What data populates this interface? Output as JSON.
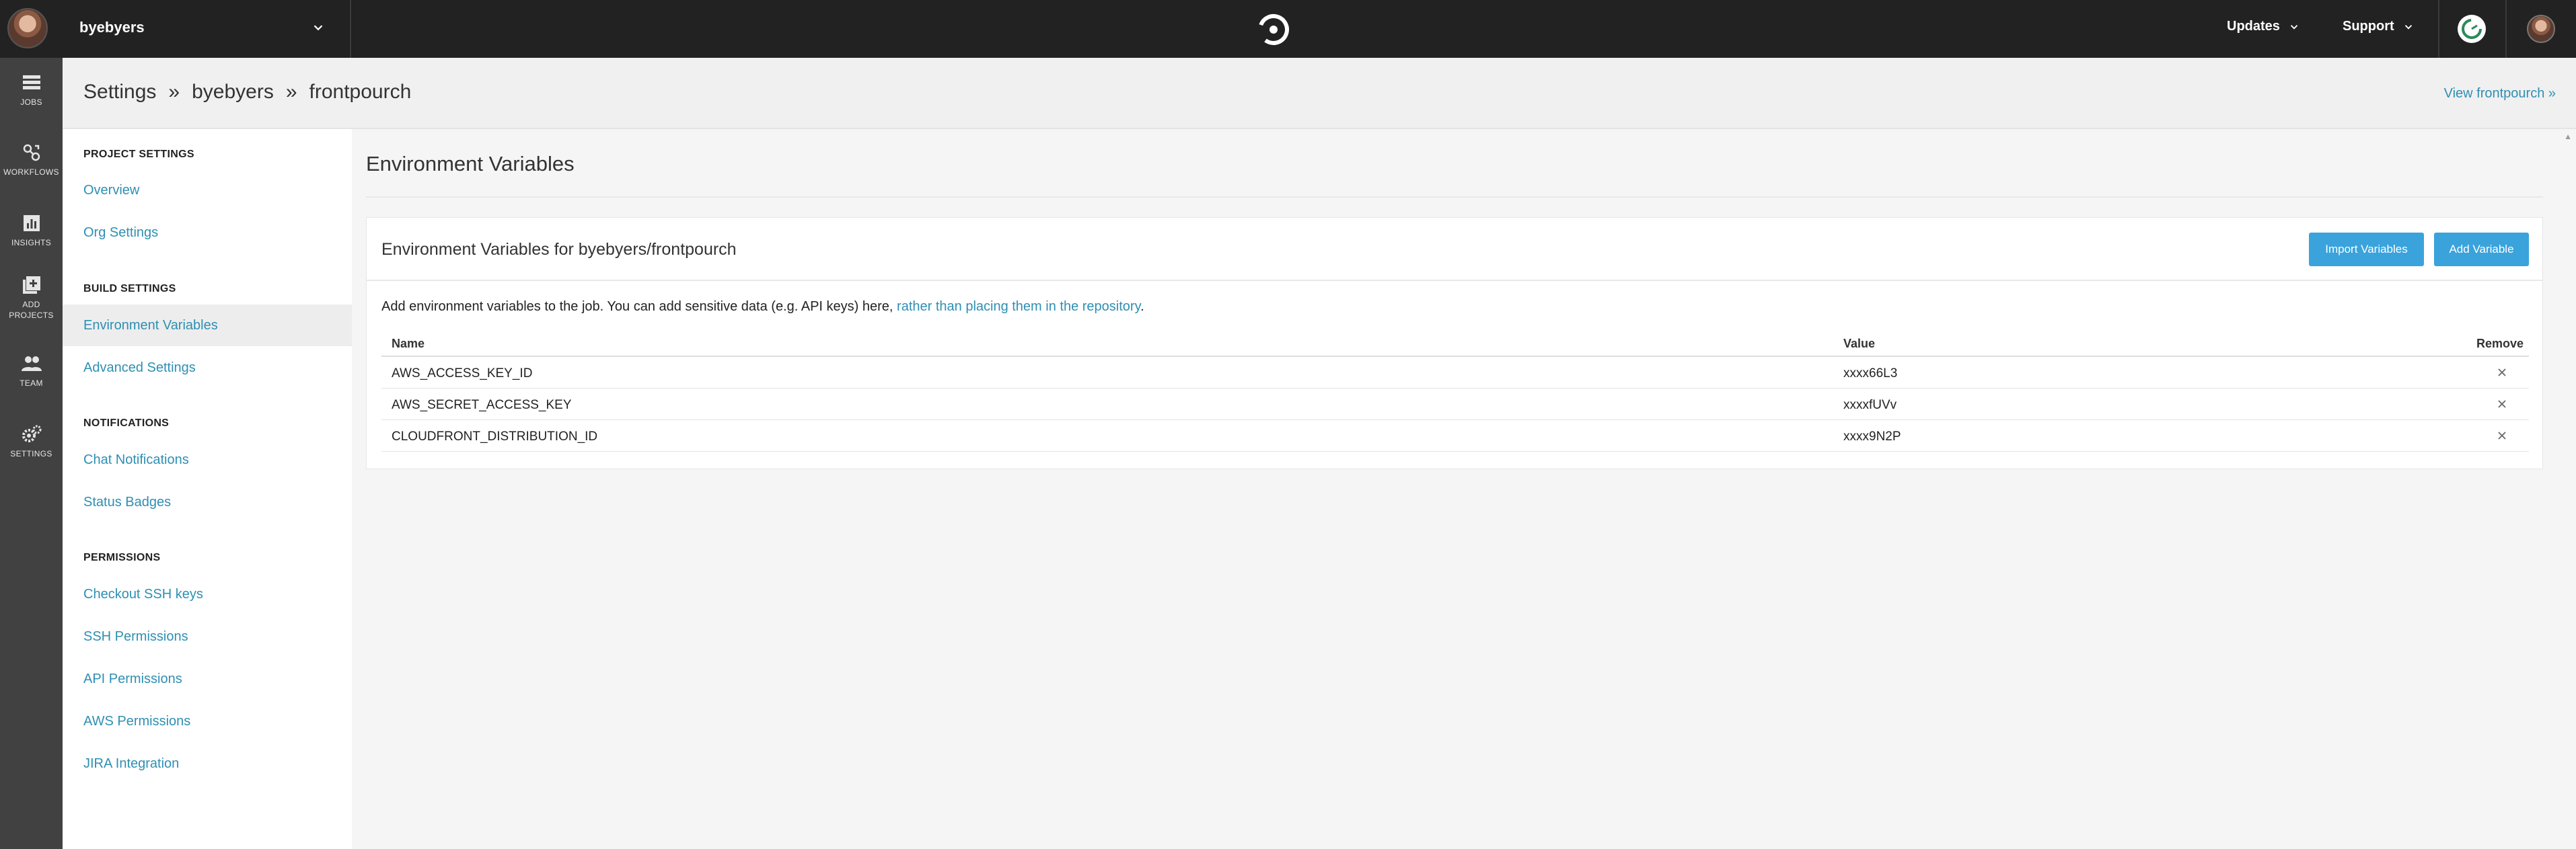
{
  "topbar": {
    "org_name": "byebyers",
    "updates_label": "Updates",
    "support_label": "Support"
  },
  "leftnav": {
    "items": [
      {
        "label": "JOBS",
        "icon": "jobs-icon"
      },
      {
        "label": "WORKFLOWS",
        "icon": "workflows-icon"
      },
      {
        "label": "INSIGHTS",
        "icon": "insights-icon"
      },
      {
        "label_line1": "ADD",
        "label_line2": "PROJECTS",
        "icon": "add-projects-icon"
      },
      {
        "label": "TEAM",
        "icon": "team-icon"
      },
      {
        "label": "SETTINGS",
        "icon": "settings-icon"
      }
    ]
  },
  "breadcrumb": {
    "root": "Settings",
    "org": "byebyers",
    "project": "frontpourch",
    "separator": "»",
    "view_link": "View frontpourch »"
  },
  "sidebar": {
    "project_settings": {
      "heading": "PROJECT SETTINGS",
      "links": [
        "Overview",
        "Org Settings"
      ]
    },
    "build_settings": {
      "heading": "BUILD SETTINGS",
      "links": [
        "Environment Variables",
        "Advanced Settings"
      ]
    },
    "notifications": {
      "heading": "NOTIFICATIONS",
      "links": [
        "Chat Notifications",
        "Status Badges"
      ]
    },
    "permissions": {
      "heading": "PERMISSIONS",
      "links": [
        "Checkout SSH keys",
        "SSH Permissions",
        "API Permissions",
        "AWS Permissions",
        "JIRA Integration"
      ]
    }
  },
  "main": {
    "title": "Environment Variables",
    "card_title": "Environment Variables for byebyers/frontpourch",
    "import_button": "Import Variables",
    "add_button": "Add Variable",
    "description": "Add environment variables to the job. You can add sensitive data (e.g. API keys) here,",
    "description_link": "rather than placing them in the repository",
    "description_end": ".",
    "table": {
      "headers": {
        "name": "Name",
        "value": "Value",
        "remove": "Remove"
      },
      "rows": [
        {
          "name": "AWS_ACCESS_KEY_ID",
          "value": "xxxx66L3"
        },
        {
          "name": "AWS_SECRET_ACCESS_KEY",
          "value": "xxxxfUVv"
        },
        {
          "name": "CLOUDFRONT_DISTRIBUTION_ID",
          "value": "xxxx9N2P"
        }
      ]
    }
  },
  "colors": {
    "topbar": "#222222",
    "leftnav": "#414141",
    "link": "#2e8fb3",
    "button": "#3aa3dc"
  }
}
